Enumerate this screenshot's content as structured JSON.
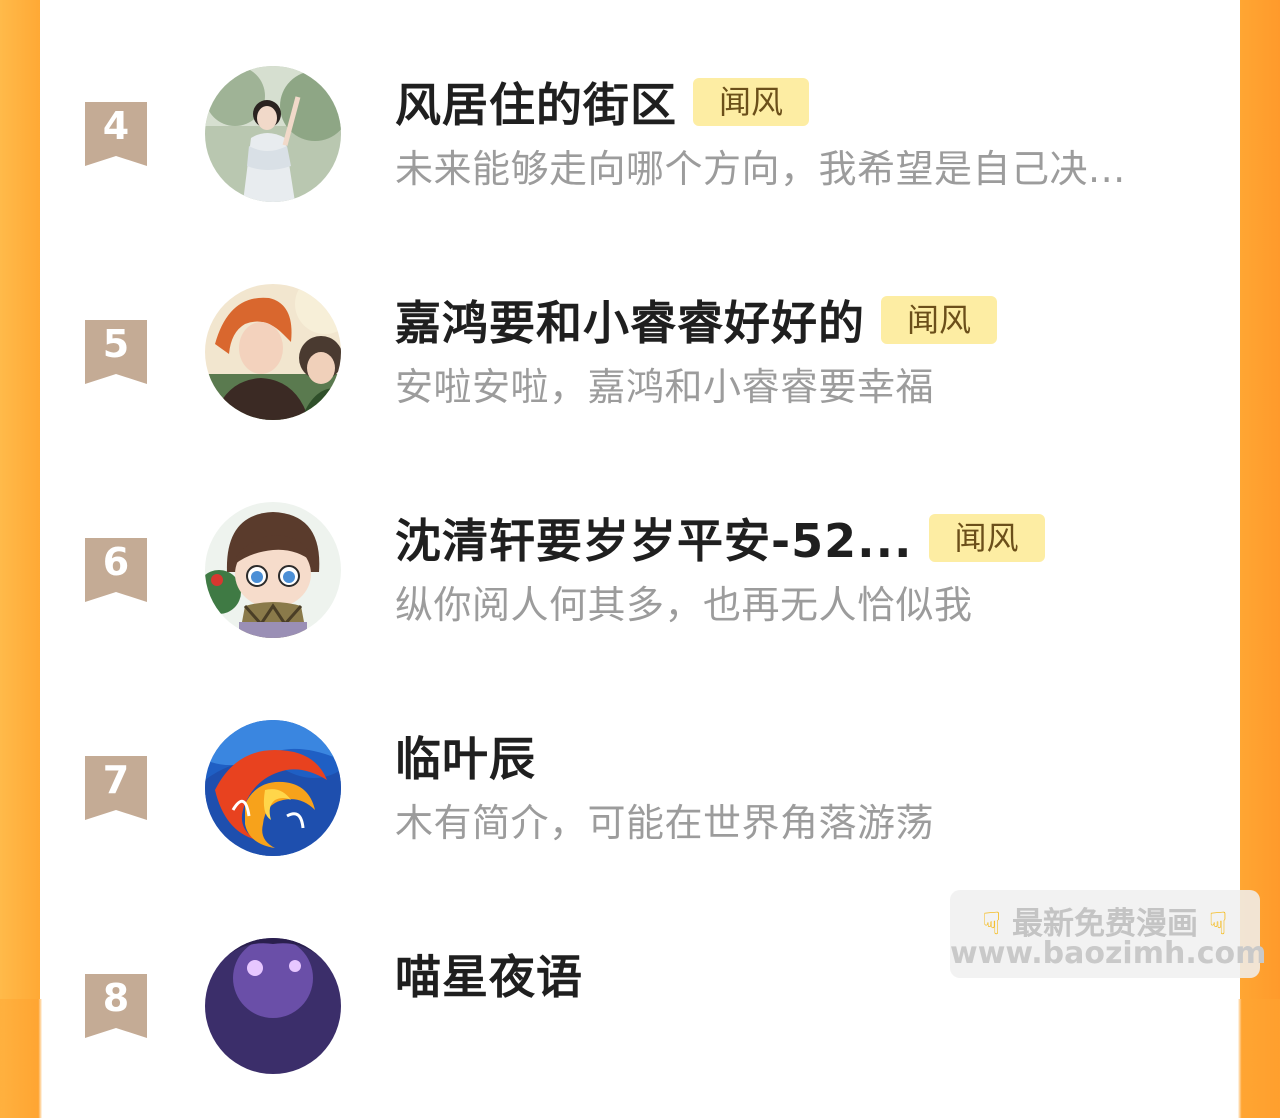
{
  "ranking": {
    "items": [
      {
        "rank": "4",
        "name": "风居住的街区",
        "tag": "闻风",
        "bio": "未来能够走向哪个方向，我希望是自己决..."
      },
      {
        "rank": "5",
        "name": "嘉鸿要和小睿睿好好的",
        "tag": "闻风",
        "bio": "安啦安啦，嘉鸿和小睿睿要幸福"
      },
      {
        "rank": "6",
        "name": "沈清轩要岁岁平安-52...",
        "tag": "闻风",
        "bio": "纵你阅人何其多，也再无人恰似我"
      },
      {
        "rank": "7",
        "name": "临叶辰",
        "tag": "",
        "bio": "木有简介，可能在世界角落游荡"
      },
      {
        "rank": "8",
        "name": "喵星夜语",
        "tag": "",
        "bio": ""
      }
    ]
  },
  "watermark": {
    "line1": "最新免费漫画",
    "line2": "www.baozimh.com",
    "icon": "pointing-down-hand-icon"
  },
  "colors": {
    "edge": "#ffa532",
    "ribbon": "#c4ab95",
    "tag_bg": "#fdeda3",
    "tag_text": "#6b4f1a",
    "name": "#1f1f1f",
    "bio": "#9c9c9c"
  }
}
